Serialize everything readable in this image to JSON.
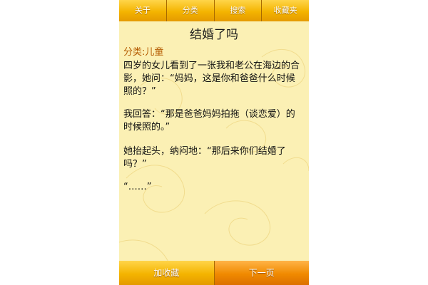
{
  "nav": {
    "tabs": [
      {
        "label": "关于"
      },
      {
        "label": "分类"
      },
      {
        "label": "搜索"
      },
      {
        "label": "收藏夹"
      }
    ]
  },
  "article": {
    "title": "结婚了吗",
    "category": "分类:儿童",
    "paragraphs": [
      "四岁的女儿看到了一张我和老公在海边的合影，她问：“妈妈，这是你和爸爸什么时候照的？”",
      "我回答：“那是爸爸妈妈拍拖（谈恋爱）的时候照的。”",
      "她抬起头，纳闷地：“那后来你们结婚了吗？”",
      "“……”"
    ]
  },
  "footer": {
    "favorite_label": "加收藏",
    "next_label": "下一页"
  },
  "colors": {
    "background": "#fbf0b4",
    "accent": "#f4b400",
    "category": "#b45a00"
  }
}
